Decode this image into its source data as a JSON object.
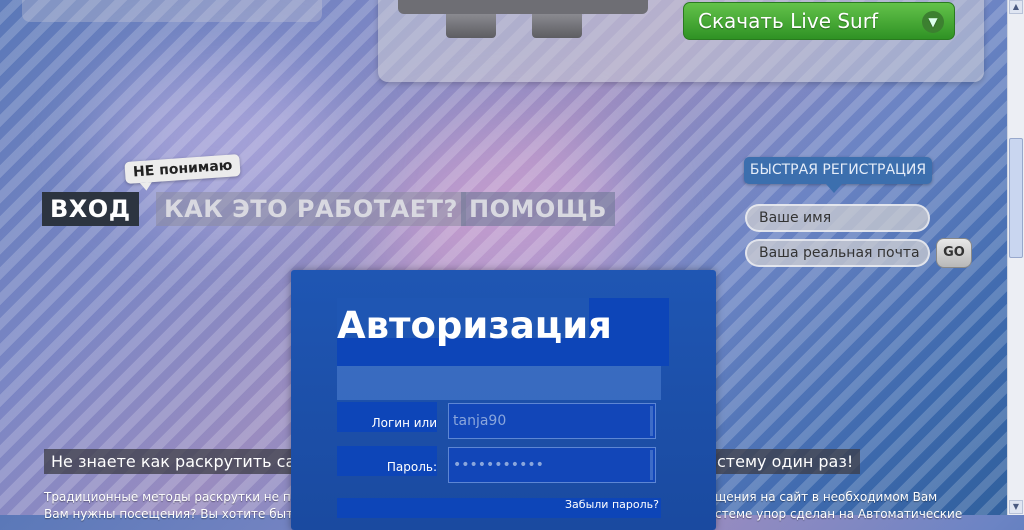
{
  "colors": {
    "download_green": "#2f9224",
    "auth_blue": "#1f56b3",
    "nav_dark": "#2c3440",
    "reg_blue": "#3c6fae"
  },
  "download": {
    "label": "Скачать Live Surf",
    "icon": "arrow-down-icon"
  },
  "nav": {
    "login": "ВХОД",
    "how": "КАК ЭТО РАБОТАЕТ?",
    "help": "ПОМОЩЬ",
    "bubble": "НЕ понимаю"
  },
  "registration": {
    "title": "БЫСТРАЯ РЕГИСТРАЦИЯ",
    "name_placeholder": "Ваше имя",
    "email_placeholder": "Ваша реальная почта",
    "go": "GO"
  },
  "promo": {
    "left": "Не знаете как раскрутить сайт",
    "right": "стему один раз!"
  },
  "description": {
    "left_line1": "Традиционные методы раскрутки не прино",
    "left_line2": "Вам нужны посещения? Вы хотите быть ре",
    "right_line1": "щения на сайт в необходимом Вам",
    "right_line2": "стеме упор сделан на Автоматические"
  },
  "auth": {
    "title": "Авторизация",
    "login_label": "Логин или Email:",
    "login_value": "tanja90",
    "password_label": "Пароль:",
    "password_value": "•••••••••••",
    "forgot": "Забыли пароль?"
  }
}
